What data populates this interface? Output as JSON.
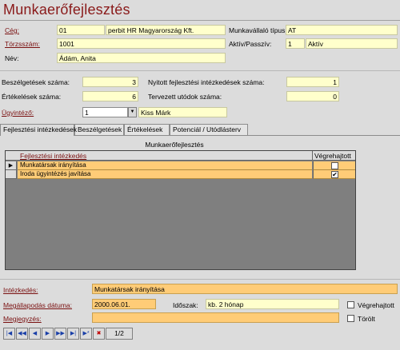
{
  "title": "Munkaerőfejlesztés",
  "header": {
    "ceg_label": "Cég:",
    "ceg_code": "01",
    "ceg_name": "perbit HR Magyarország Kft.",
    "torzsszam_label": "Törzsszám:",
    "torzsszam": "1001",
    "nev_label": "Név:",
    "nev": "Ádám, Anita",
    "tipus_label": "Munkavállaló típus:",
    "tipus": "AT",
    "aktiv_label": "Aktív/Passzív:",
    "aktiv_code": "1",
    "aktiv_text": "Aktív"
  },
  "stats": {
    "beszelgetesek_label": "Beszélgetések száma:",
    "beszelgetesek": "3",
    "ertekelesek_label": "Értékelések száma:",
    "ertekelesek": "6",
    "nyitott_label": "Nyitott fejlesztési intézkedések száma:",
    "nyitott": "1",
    "utodok_label": "Tervezett utódok száma:",
    "utodok": "0",
    "ugyintezo_label": "Ügyintéző:",
    "ugyintezo_code": "1",
    "ugyintezo_name": "Kiss Márk"
  },
  "tabs": [
    {
      "label": "Fejlesztési intézkedések"
    },
    {
      "label": "Beszélgetések"
    },
    {
      "label": "Értékelések"
    },
    {
      "label": "Potenciál / Utódlásterv"
    }
  ],
  "grid": {
    "title": "Munkaerőfejlesztés",
    "col1": "Fejlesztési intézkedés",
    "col2": "Végrehajtott",
    "rows": [
      {
        "text": "Munkatársak irányítása",
        "checked": false,
        "mark": "▶"
      },
      {
        "text": "Iroda ügyintézés javítása",
        "checked": true,
        "mark": ""
      }
    ]
  },
  "detail": {
    "intezkedes_label": "Intézkedés:",
    "intezkedes": "Munkatársak irányítása",
    "datum_label": "Megállapodás dátuma:",
    "datum": "2000.06.01.",
    "idoszak_label": "Időszak:",
    "idoszak": "kb. 2 hónap",
    "megjegyzes_label": "Megjegyzés:",
    "megjegyzes": "",
    "vegrehajtott_label": "Végrehajtott",
    "torolt_label": "Törölt"
  },
  "nav": {
    "record": "1/2"
  }
}
